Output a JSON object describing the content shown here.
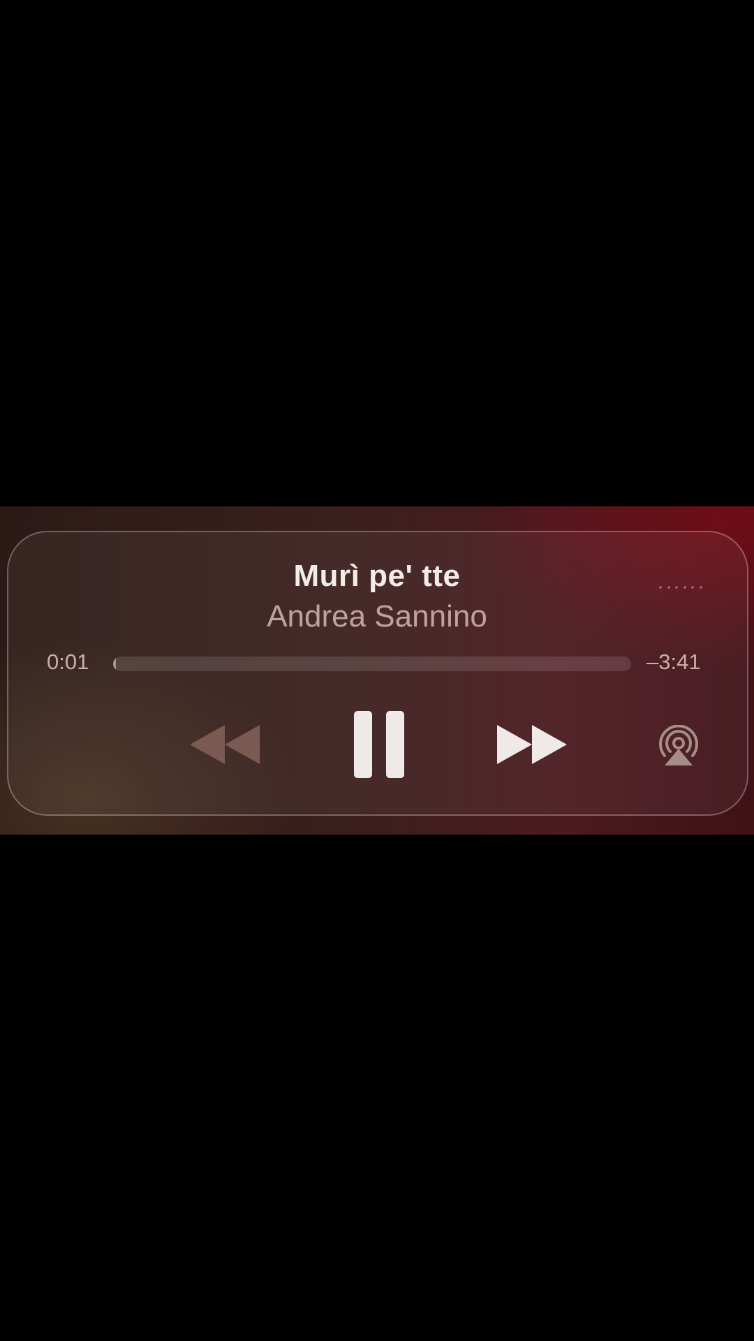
{
  "now_playing": {
    "title": "Murì pe' tte",
    "artist": "Andrea Sannino",
    "elapsed": "0:01",
    "remaining": "–3:41",
    "progress_fraction": 0.005
  },
  "controls": {
    "rewind_icon": "rewind-icon",
    "pause_icon": "pause-icon",
    "forward_icon": "fast-forward-icon",
    "airplay_icon": "airplay-icon",
    "more_icon": "more-dots-icon"
  },
  "colors": {
    "accent_dark_red": "#4a1a20",
    "background": "#000000"
  }
}
